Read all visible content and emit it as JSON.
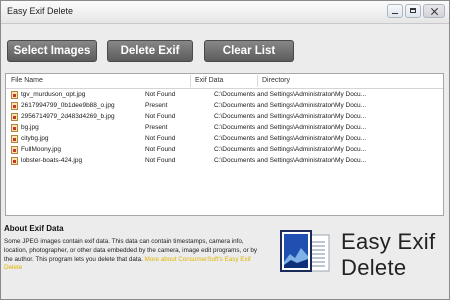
{
  "window": {
    "title": "Easy Exif Delete"
  },
  "toolbar": {
    "select_label": "Select Images",
    "delete_label": "Delete Exif",
    "clear_label": "Clear List"
  },
  "table": {
    "columns": {
      "file_name": "File Name",
      "exif_data": "Exif Data",
      "directory": "Directory"
    },
    "rows": [
      {
        "name": "tgv_murduson_opt.jpg",
        "exif": "Not Found",
        "dir": "C:\\Documents and Settings\\Administrator\\My Docu..."
      },
      {
        "name": "2617994799_0b1dee9b88_o.jpg",
        "exif": "Present",
        "dir": "C:\\Documents and Settings\\Administrator\\My Docu..."
      },
      {
        "name": "2956714979_2d483d4269_b.jpg",
        "exif": "Not Found",
        "dir": "C:\\Documents and Settings\\Administrator\\My Docu..."
      },
      {
        "name": "bg.jpg",
        "exif": "Present",
        "dir": "C:\\Documents and Settings\\Administrator\\My Docu..."
      },
      {
        "name": "citybg.jpg",
        "exif": "Not Found",
        "dir": "C:\\Documents and Settings\\Administrator\\My Docu..."
      },
      {
        "name": "FullMoony.jpg",
        "exif": "Not Found",
        "dir": "C:\\Documents and Settings\\Administrator\\My Docu..."
      },
      {
        "name": "lobster-boats-424.jpg",
        "exif": "Not Found",
        "dir": "C:\\Documents and Settings\\Administrator\\My Docu..."
      }
    ]
  },
  "about": {
    "heading": "About Exif Data",
    "text": "Some JPEG images contain exif data. This data can contain timestamps, camera info, location, photographer, or other data embedded by the camera, image edit programs, or by the author. This program lets you delete that data.",
    "more_link": "More about ConsumerSoft's Easy Exif Delete"
  },
  "logo": {
    "line1": "Easy Exif",
    "line2": "Delete"
  },
  "colors": {
    "button_fill": "#6e6e6e",
    "link": "#e0b400",
    "window_bg": "#ececec"
  }
}
